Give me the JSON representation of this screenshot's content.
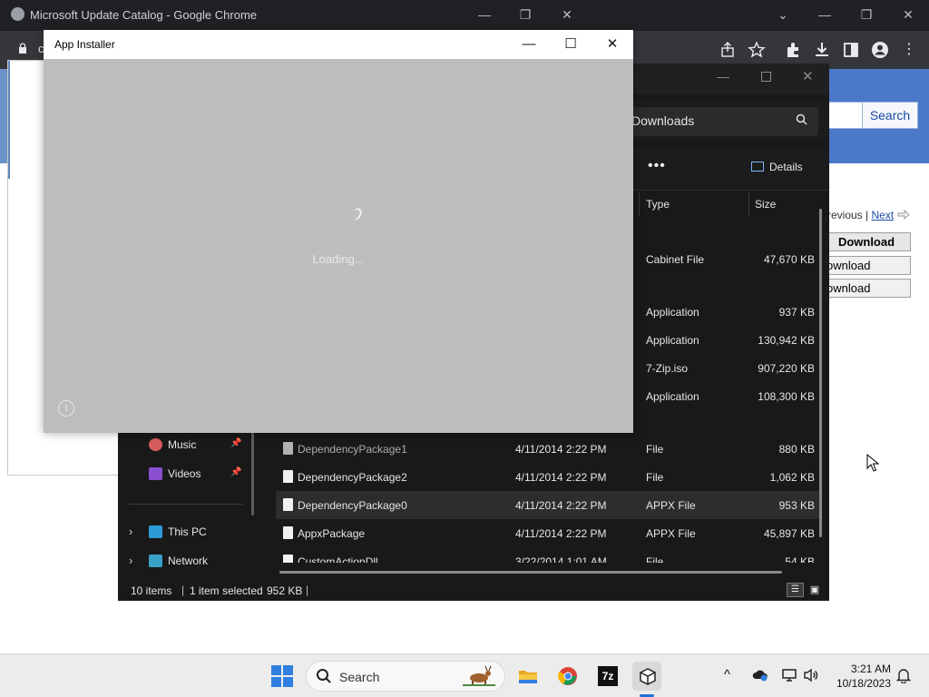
{
  "chrome": {
    "title": "Microsoft Update Catalog - Google Chrome",
    "window_controls": {
      "minimize": "—",
      "restore": "❐",
      "close": "✕"
    },
    "tab_search": "⌄",
    "address_partial": "c",
    "page": {
      "search_button": "Search",
      "pager_previous": "revious |",
      "pager_next": "Next",
      "download_header": "Download",
      "download_1": "ownload",
      "download_2": "ownload"
    }
  },
  "explorer": {
    "search_placeholder": "Downloads",
    "more_label": "•••",
    "details_label": "Details",
    "columns": {
      "type": "Type",
      "size": "Size"
    },
    "nav": [
      {
        "label": "Music",
        "icon": "music-icon",
        "pinned": true
      },
      {
        "label": "Videos",
        "icon": "videos-icon",
        "pinned": true
      },
      {
        "label": "This PC",
        "icon": "this-pc-icon",
        "pinned": false
      },
      {
        "label": "Network",
        "icon": "network-icon",
        "pinned": false
      }
    ],
    "files_top": [
      {
        "type": "Cabinet File",
        "size": "47,670 KB"
      },
      {
        "type": "Application",
        "size": "937 KB"
      },
      {
        "type": "Application",
        "size": "130,942 KB"
      },
      {
        "type": "7-Zip.iso",
        "size": "907,220 KB"
      },
      {
        "type": "Application",
        "size": "108,300 KB"
      }
    ],
    "files": [
      {
        "name": "DependencyPackage1",
        "date": "4/11/2014 2:22 PM",
        "type": "File",
        "size": "880 KB"
      },
      {
        "name": "DependencyPackage2",
        "date": "4/11/2014 2:22 PM",
        "type": "File",
        "size": "1,062 KB"
      },
      {
        "name": "DependencyPackage0",
        "date": "4/11/2014 2:22 PM",
        "type": "APPX File",
        "size": "953 KB"
      },
      {
        "name": "AppxPackage",
        "date": "4/11/2014 2:22 PM",
        "type": "APPX File",
        "size": "45,897 KB"
      },
      {
        "name": "CustomActionDll",
        "date": "3/22/2014 1:01 AM",
        "type": "File",
        "size": "54 KB"
      }
    ],
    "status": {
      "count": "10 items",
      "selected": "1 item selected",
      "size": "952 KB"
    }
  },
  "app_installer": {
    "title": "App Installer",
    "loading_text": "Loading...",
    "info_icon": "i"
  },
  "taskbar": {
    "search_label": "Search",
    "clock_time": "3:21 AM",
    "clock_date": "10/18/2023",
    "apps": [
      "file-explorer-icon",
      "chrome-icon",
      "7zip-icon",
      "app-installer-icon"
    ],
    "seven_zip_label": "7z"
  },
  "colors": {
    "accent": "#2f7fe0",
    "installer_bg": "#bdbdbd",
    "explorer_bg": "#191919"
  }
}
